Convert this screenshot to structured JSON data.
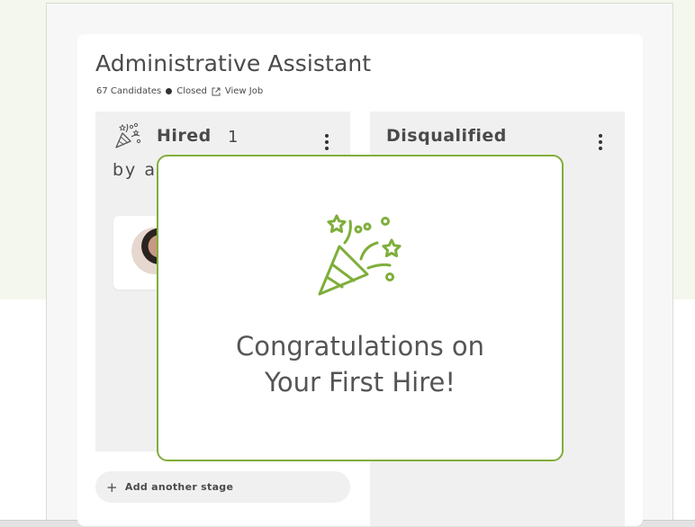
{
  "job": {
    "title": "Administrative Assistant",
    "candidates": "67 Candidates",
    "status": "Closed",
    "view_job": "View Job"
  },
  "columns": {
    "hired": {
      "label": "Hired",
      "count": "1",
      "subtext": "by a"
    },
    "disqualified": {
      "label": "Disqualified"
    }
  },
  "add_stage": {
    "label": "Add another stage",
    "icon": "plus-icon"
  },
  "modal": {
    "line1": "Congratulations on",
    "line2": "Your First Hire!",
    "icon": "party-popper-icon"
  },
  "colors": {
    "accent": "#7fae3b",
    "background_tint": "#f4f7ee",
    "column_bg": "#f0f0f0",
    "text": "#4a4a4a"
  }
}
